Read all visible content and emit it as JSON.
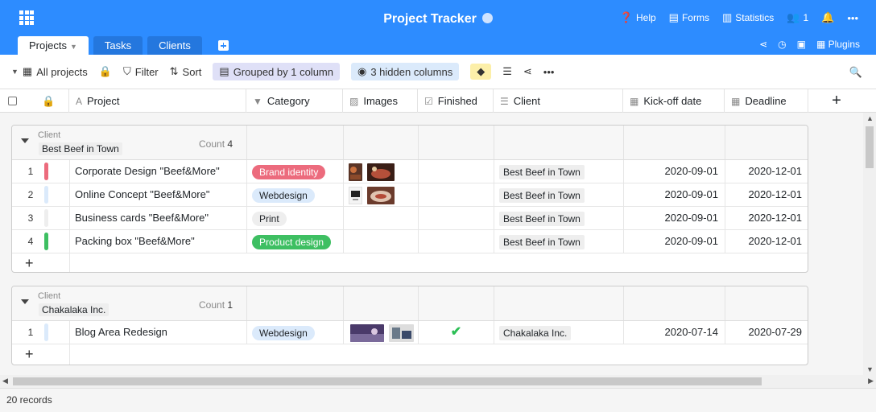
{
  "app": {
    "title": "Project Tracker"
  },
  "top_links": {
    "help": "Help",
    "forms": "Forms",
    "statistics": "Statistics",
    "users_count": "1"
  },
  "tabs": [
    {
      "label": "Projects"
    },
    {
      "label": "Tasks"
    },
    {
      "label": "Clients"
    }
  ],
  "right_tools": {
    "plugins": "Plugins"
  },
  "toolbar": {
    "view": "All projects",
    "filter": "Filter",
    "sort": "Sort",
    "grouped": "Grouped by 1 column",
    "hidden": "3 hidden columns"
  },
  "columns": {
    "project": "Project",
    "category": "Category",
    "images": "Images",
    "finished": "Finished",
    "client": "Client",
    "kickoff": "Kick-off date",
    "deadline": "Deadline"
  },
  "groups": [
    {
      "label": "Client",
      "value": "Best Beef in Town",
      "count_label": "Count",
      "count": "4",
      "rows": [
        {
          "num": "1",
          "project": "Corporate Design \"Beef&More\"",
          "category": "Brand identity",
          "client": "Best Beef in Town",
          "kickoff": "2020-09-01",
          "deadline": "2020-12-01"
        },
        {
          "num": "2",
          "project": "Online Concept \"Beef&More\"",
          "category": "Webdesign",
          "client": "Best Beef in Town",
          "kickoff": "2020-09-01",
          "deadline": "2020-12-01"
        },
        {
          "num": "3",
          "project": "Business cards \"Beef&More\"",
          "category": "Print",
          "client": "Best Beef in Town",
          "kickoff": "2020-09-01",
          "deadline": "2020-12-01"
        },
        {
          "num": "4",
          "project": "Packing box \"Beef&More\"",
          "category": "Product design",
          "client": "Best Beef in Town",
          "kickoff": "2020-09-01",
          "deadline": "2020-12-01"
        }
      ]
    },
    {
      "label": "Client",
      "value": "Chakalaka Inc.",
      "count_label": "Count",
      "count": "1",
      "rows": [
        {
          "num": "1",
          "project": "Blog Area Redesign",
          "category": "Webdesign",
          "client": "Chakalaka Inc.",
          "kickoff": "2020-07-14",
          "deadline": "2020-07-29"
        }
      ]
    }
  ],
  "colors": {
    "brand": "#2d8cff",
    "brand_identity": "#ec6b7d",
    "webdesign": "#dbeafb",
    "print": "#eeeeee",
    "product_design": "#3ebf62",
    "check": "#2cbf55"
  },
  "footer": {
    "records": "20 records"
  }
}
